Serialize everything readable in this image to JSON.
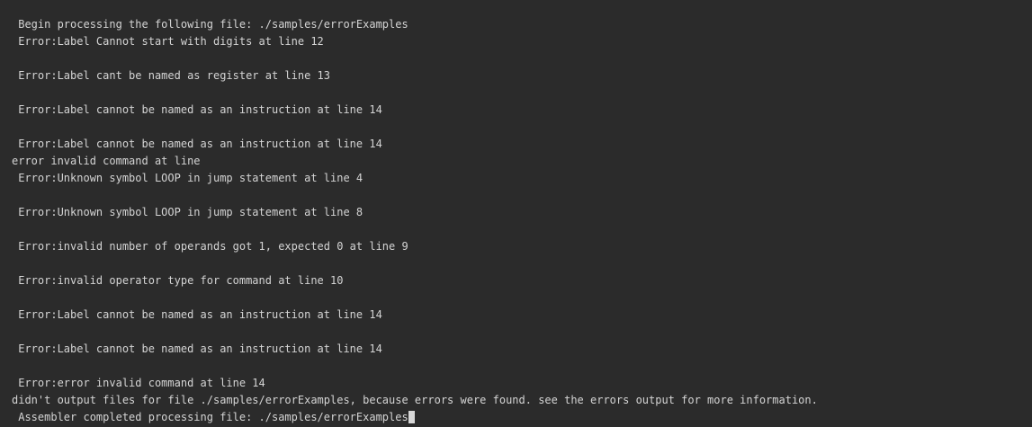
{
  "console": {
    "lines": [
      " Begin processing the following file: ./samples/errorExamples",
      " Error:Label Cannot start with digits at line 12",
      "",
      " Error:Label cant be named as register at line 13",
      "",
      " Error:Label cannot be named as an instruction at line 14",
      "",
      " Error:Label cannot be named as an instruction at line 14",
      "error invalid command at line",
      " Error:Unknown symbol LOOP in jump statement at line 4",
      "",
      " Error:Unknown symbol LOOP in jump statement at line 8",
      "",
      " Error:invalid number of operands got 1, expected 0 at line 9",
      "",
      " Error:invalid operator type for command at line 10",
      "",
      " Error:Label cannot be named as an instruction at line 14",
      "",
      " Error:Label cannot be named as an instruction at line 14",
      "",
      " Error:error invalid command at line 14",
      "didn't output files for file ./samples/errorExamples, because errors were found. see the errors output for more information.",
      " Assembler completed processing file: ./samples/errorExamples"
    ]
  }
}
